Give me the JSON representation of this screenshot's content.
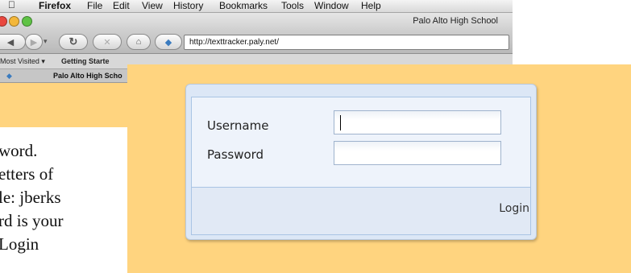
{
  "browser": {
    "app_name": "Firefox",
    "menu": [
      "File",
      "Edit",
      "View",
      "History",
      "Bookmarks",
      "Tools",
      "Window",
      "Help"
    ],
    "window_title": "Palo Alto High School",
    "url": "http://texttracker.paly.net/",
    "bookmarks": [
      "Most Visited",
      "Getting Starte"
    ],
    "tab_title": "Palo Alto High Scho"
  },
  "instructions": [
    "word.",
    "etters of",
    "le: jberks",
    "rd is your",
    "Login"
  ],
  "login": {
    "username_label": "Username",
    "password_label": "Password",
    "username_value": "",
    "password_value": "",
    "login_button": "Login"
  },
  "colors": {
    "page_background": "#ffd47f",
    "panel": "#dce7f6",
    "panel_border": "#a9c4e4"
  }
}
